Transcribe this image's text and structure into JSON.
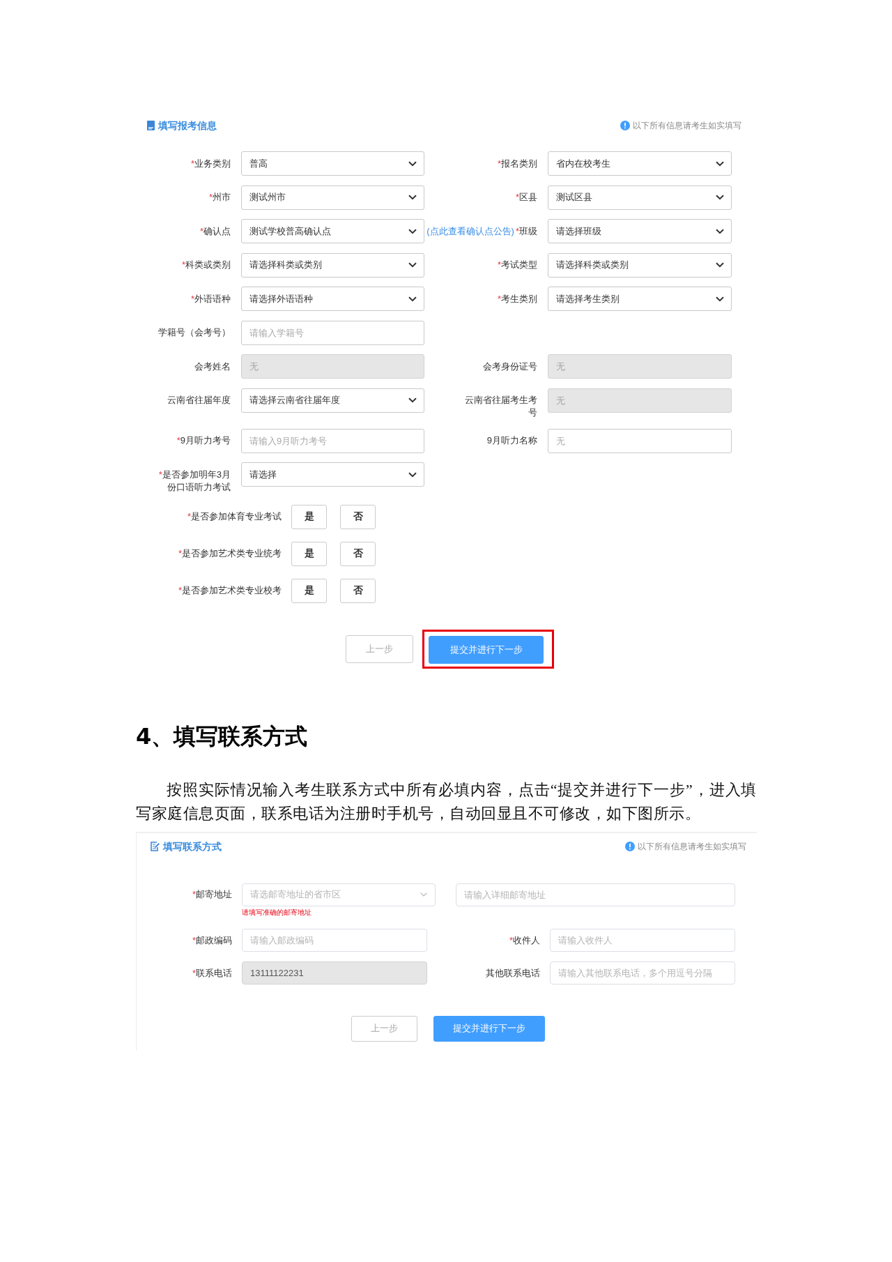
{
  "form_1": {
    "title": "填写报考信息",
    "note": "以下所有信息请考生如实填写",
    "rows": [
      {
        "left": {
          "label": "业务类别",
          "required_mark": "*",
          "kind": "select",
          "value": "普高",
          "disabled": false
        },
        "right": {
          "label": "报名类别",
          "required_mark": "*",
          "kind": "select",
          "value": "省内在校考生",
          "disabled": false
        }
      },
      {
        "left": {
          "label": "州市",
          "required_mark": "*",
          "kind": "select",
          "value": "测试州市",
          "disabled": false
        },
        "right": {
          "label": "区县",
          "required_mark": "*",
          "kind": "select",
          "value": "测试区县",
          "disabled": false
        }
      },
      {
        "left": {
          "label": "确认点",
          "required_mark": "*",
          "kind": "select",
          "value": "测试学校普高确认点",
          "disabled": false
        },
        "link": "(点此查看确认点公告)",
        "right": {
          "label": "班级",
          "required_mark": "*",
          "kind": "select",
          "value": "请选择班级",
          "disabled": false
        }
      },
      {
        "left": {
          "label": "科类或类别",
          "required_mark": "*",
          "kind": "select",
          "value": "请选择科类或类别",
          "disabled": false
        },
        "right": {
          "label": "考试类型",
          "required_mark": "*",
          "kind": "select",
          "value": "请选择科类或类别",
          "disabled": false
        }
      },
      {
        "left": {
          "label": "外语语种",
          "required_mark": "*",
          "kind": "select",
          "value": "请选择外语语种",
          "disabled": false
        },
        "right": {
          "label": "考生类别",
          "required_mark": "*",
          "kind": "select",
          "value": "请选择考生类别",
          "disabled": false
        }
      },
      {
        "left": {
          "label": "学籍号（会考号）",
          "kind": "input",
          "placeholder": "请输入学籍号",
          "disabled": false
        }
      },
      {
        "left": {
          "label": "会考姓名",
          "kind": "input",
          "placeholder": "无",
          "disabled": true
        },
        "right": {
          "label": "会考身份证号",
          "kind": "input",
          "placeholder": "无",
          "disabled": true
        }
      },
      {
        "left": {
          "label": "云南省往届年度",
          "kind": "select",
          "value": "请选择云南省往届年度",
          "disabled": false
        },
        "right": {
          "label": "云南省往届考生考号",
          "kind": "input",
          "placeholder": "无",
          "disabled": true
        }
      },
      {
        "left": {
          "label": "9月听力考号",
          "required_mark": "*",
          "kind": "input",
          "placeholder": "请输入9月听力考号",
          "disabled": false
        },
        "right": {
          "label": "9月听力名称",
          "kind": "input",
          "placeholder": "无",
          "disabled": false
        }
      },
      {
        "left": {
          "label": "是否参加明年3月份口语听力考试",
          "required_mark": "*",
          "kind": "select",
          "value": "请选择",
          "disabled": false
        }
      }
    ],
    "choices": [
      {
        "label": "是否参加体育专业考试",
        "required_mark": "*",
        "options": [
          {
            "label": "是",
            "selected": false
          },
          {
            "label": "否",
            "selected": false
          }
        ]
      },
      {
        "label": "是否参加艺术类专业统考",
        "required_mark": "*",
        "options": [
          {
            "label": "是",
            "selected": false
          },
          {
            "label": "否",
            "selected": false
          }
        ]
      },
      {
        "label": "是否参加艺术类专业校考",
        "required_mark": "*",
        "options": [
          {
            "label": "是",
            "selected": false
          },
          {
            "label": "否",
            "selected": false
          }
        ]
      }
    ],
    "buttons": [
      {
        "label": "上一步",
        "kind": "secondary",
        "highlighted": false
      },
      {
        "label": "提交并进行下一步",
        "kind": "primary",
        "highlighted": true
      }
    ]
  },
  "heading": "4、填写联系方式",
  "paragraph": "按照实际情况输入考生联系方式中所有必填内容，点击“提交并进行下一步”，进入填写家庭信息页面，联系电话为注册时手机号，自动回显且不可修改，如下图所示。",
  "form_2": {
    "title": "填写联系方式",
    "note": "以下所有信息请考生如实填写",
    "rows": [
      {
        "left": {
          "label": "邮寄地址",
          "required_mark": "*",
          "kind": "select",
          "placeholder": "请选邮寄地址的省市区",
          "disabled": false,
          "error": "请填写准确的邮寄地址"
        },
        "right": {
          "kind": "input",
          "placeholder": "请输入详细邮寄地址",
          "disabled": false
        }
      },
      {
        "left": {
          "label": "邮政编码",
          "required_mark": "*",
          "kind": "input",
          "placeholder": "请输入邮政编码",
          "disabled": false
        },
        "right": {
          "label": "收件人",
          "required_mark": "*",
          "kind": "input",
          "placeholder": "请输入收件人",
          "disabled": false
        }
      },
      {
        "left": {
          "label": "联系电话",
          "required_mark": "*",
          "kind": "input",
          "value": "13111122231",
          "disabled": true
        },
        "right": {
          "label": "其他联系电话",
          "kind": "input",
          "placeholder": "请输入其他联系电话，多个用逗号分隔",
          "disabled": false
        }
      }
    ],
    "buttons": [
      {
        "label": "上一步",
        "kind": "secondary"
      },
      {
        "label": "提交并进行下一步",
        "kind": "primary"
      }
    ]
  }
}
